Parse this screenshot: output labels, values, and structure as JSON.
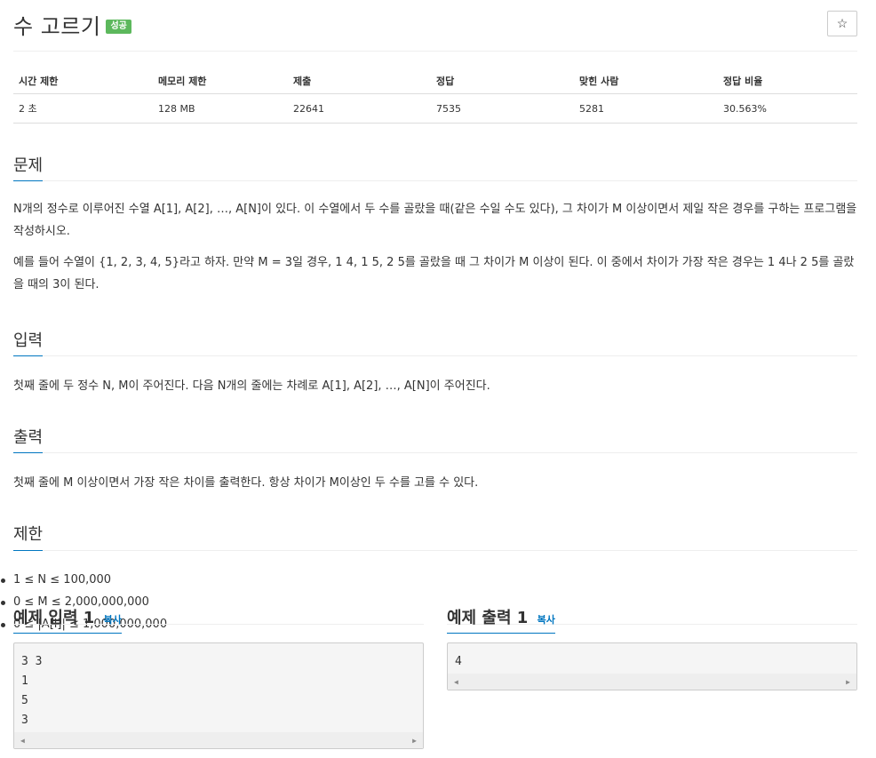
{
  "header": {
    "title": "수 고르기",
    "badge": "성공",
    "star": "☆"
  },
  "info": {
    "headers": [
      "시간 제한",
      "메모리 제한",
      "제출",
      "정답",
      "맞힌 사람",
      "정답 비율"
    ],
    "values": [
      "2 초",
      "128 MB",
      "22641",
      "7535",
      "5281",
      "30.563%"
    ]
  },
  "problem": {
    "title": "문제",
    "paragraphs": [
      "N개의 정수로 이루어진 수열 A[1], A[2], …, A[N]이 있다. 이 수열에서 두 수를 골랐을 때(같은 수일 수도 있다), 그 차이가 M 이상이면서 제일 작은 경우를 구하는 프로그램을 작성하시오.",
      "예를 들어 수열이 {1, 2, 3, 4, 5}라고 하자. 만약 M = 3일 경우, 1 4, 1 5, 2 5를 골랐을 때 그 차이가 M 이상이 된다. 이 중에서 차이가 가장 작은 경우는 1 4나 2 5를 골랐을 때의 3이 된다."
    ]
  },
  "input": {
    "title": "입력",
    "text": "첫째 줄에 두 정수 N, M이 주어진다. 다음 N개의 줄에는 차례로 A[1], A[2], …, A[N]이 주어진다."
  },
  "output": {
    "title": "출력",
    "text": "첫째 줄에 M 이상이면서 가장 작은 차이를 출력한다. 항상 차이가 M이상인 두 수를 고를 수 있다."
  },
  "limits": {
    "title": "제한",
    "items": [
      "1 ≤ N ≤ 100,000",
      "0 ≤ M ≤ 2,000,000,000",
      "0 ≤ |A[i]| ≤ 1,000,000,000"
    ]
  },
  "samples": {
    "input": {
      "title": "예제 입력 1",
      "copy": "복사",
      "content": "3 3\n1\n5\n3"
    },
    "output": {
      "title": "예제 출력 1",
      "copy": "복사",
      "content": "4"
    }
  },
  "icons": {
    "scroll_left": "◀",
    "scroll_right": "▶"
  },
  "colors": {
    "badge_success": "#5cb85c",
    "link": "#0076c0"
  }
}
